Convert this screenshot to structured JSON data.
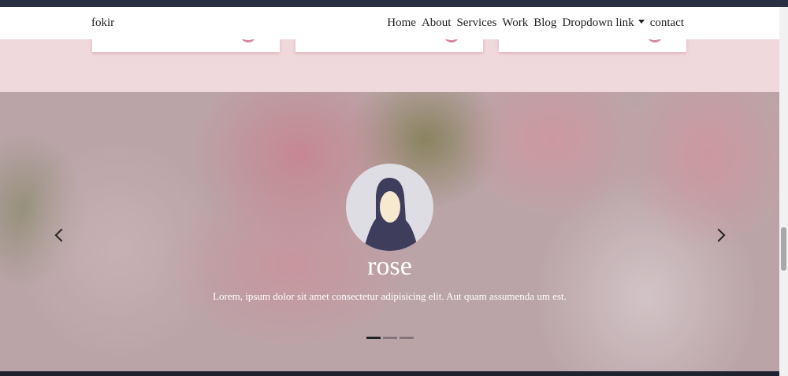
{
  "navbar": {
    "brand": "fokir",
    "items": [
      "Home",
      "About",
      "Services",
      "Work",
      "Blog",
      "Dropdown link",
      "contact"
    ]
  },
  "slide": {
    "title": "rose",
    "description": "Lorem, ipsum dolor sit amet consectetur adipisicing elit. Aut quam assumenda um est.",
    "active_index": 0,
    "total": 3
  }
}
